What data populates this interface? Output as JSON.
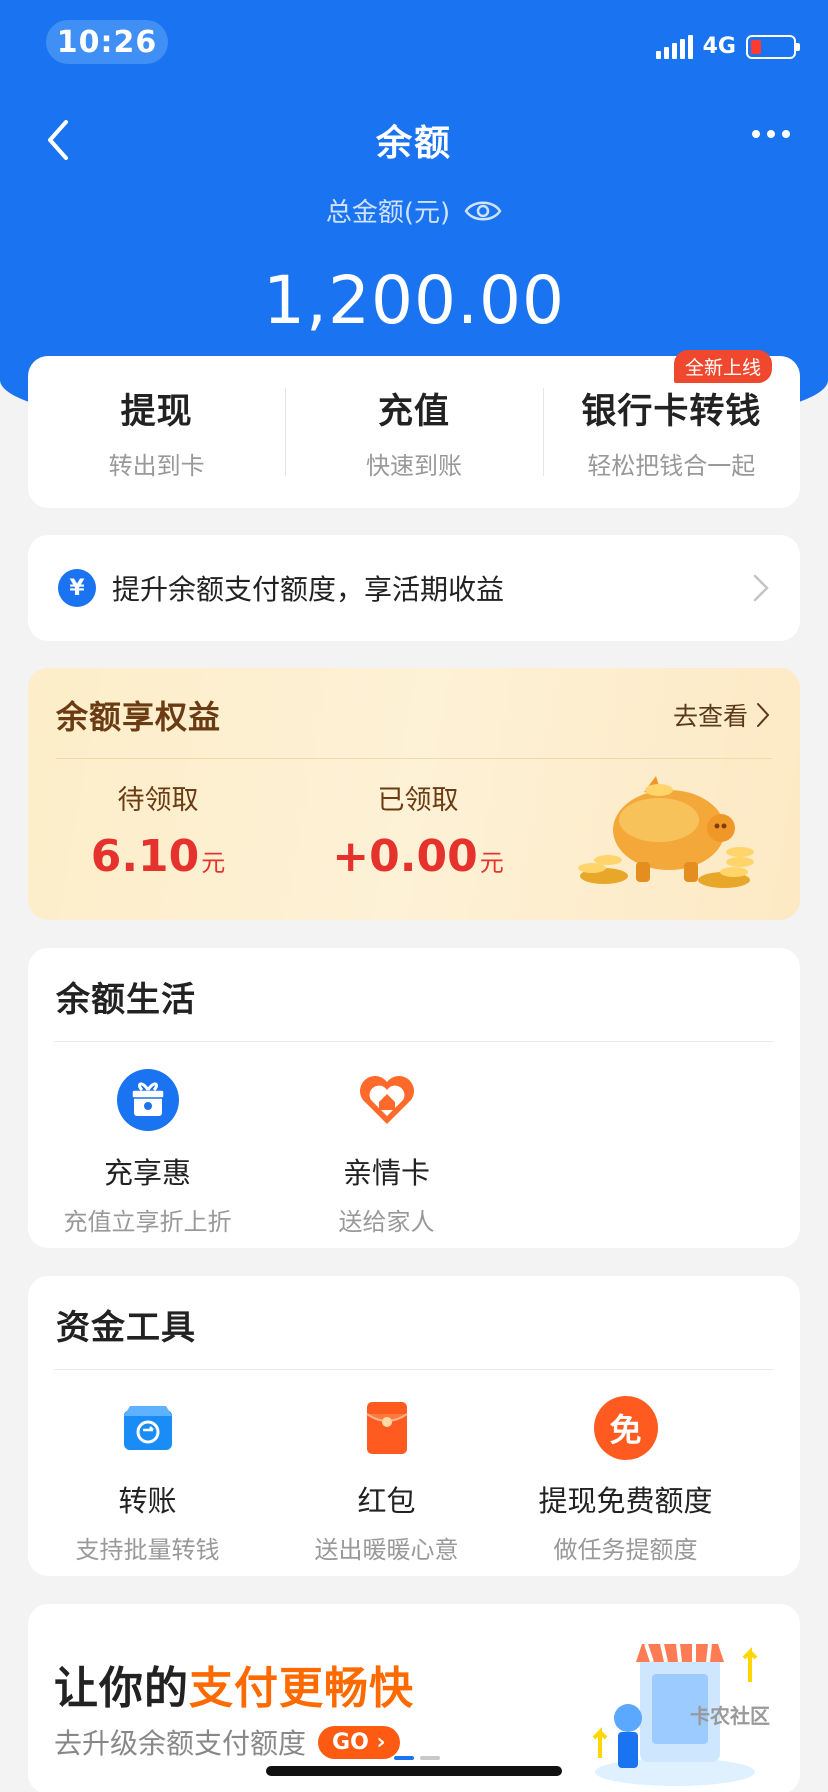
{
  "status": {
    "time": "10:26",
    "network": "4G"
  },
  "nav": {
    "title": "余额"
  },
  "balance": {
    "label": "总金额(元)",
    "amount": "1,200.00"
  },
  "actions": [
    {
      "title": "提现",
      "sub": "转出到卡"
    },
    {
      "title": "充值",
      "sub": "快速到账"
    },
    {
      "title": "银行卡转钱",
      "sub": "轻松把钱合一起",
      "badge": "全新上线"
    }
  ],
  "upgrade": {
    "icon_text": "¥",
    "text": "提升余额支付额度，享活期收益"
  },
  "rights": {
    "title": "余额享权益",
    "link": "去查看",
    "pending_label": "待领取",
    "pending_value": "6.10",
    "pending_unit": "元",
    "claimed_label": "已领取",
    "claimed_value": "+0.00",
    "claimed_unit": "元"
  },
  "life": {
    "title": "余额生活",
    "items": [
      {
        "title": "充享惠",
        "sub": "充值立享折上折",
        "icon": "gift-icon"
      },
      {
        "title": "亲情卡",
        "sub": "送给家人",
        "icon": "family-card-icon"
      }
    ]
  },
  "tools": {
    "title": "资金工具",
    "items": [
      {
        "title": "转账",
        "sub": "支持批量转钱",
        "icon": "transfer-icon"
      },
      {
        "title": "红包",
        "sub": "送出暖暖心意",
        "icon": "red-envelope-icon"
      },
      {
        "title": "提现免费额度",
        "sub": "做任务提额度",
        "icon": "free-icon",
        "icon_text": "免"
      }
    ]
  },
  "promo": {
    "title_prefix": "让你的",
    "title_highlight": "支付更畅快",
    "sub": "去升级余额支付额度",
    "go": "GO",
    "watermark": "卡农社区"
  },
  "colors": {
    "brand_blue": "#1a73f0",
    "orange": "#ff6a00",
    "red": "#e5322d"
  }
}
